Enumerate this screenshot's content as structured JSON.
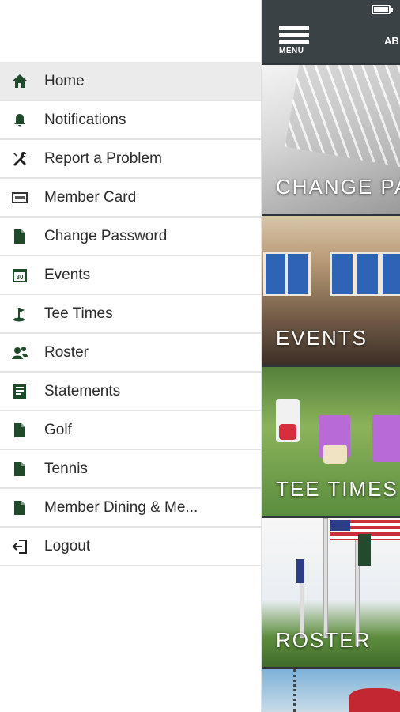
{
  "app": {
    "menu_label": "MENU",
    "header_partial": "AB",
    "tiles": [
      {
        "caption": "CHANGE PA"
      },
      {
        "caption": "EVENTS"
      },
      {
        "caption": "TEE TIMES"
      },
      {
        "caption": "ROSTER"
      }
    ]
  },
  "drawer": {
    "items": [
      {
        "label": "Home",
        "icon": "home-icon",
        "active": true
      },
      {
        "label": "Notifications",
        "icon": "bell-icon"
      },
      {
        "label": "Report a Problem",
        "icon": "tools-icon"
      },
      {
        "label": "Member Card",
        "icon": "card-icon"
      },
      {
        "label": "Change Password",
        "icon": "document-icon"
      },
      {
        "label": "Events",
        "icon": "calendar-icon"
      },
      {
        "label": "Tee Times",
        "icon": "golf-flag-icon"
      },
      {
        "label": "Roster",
        "icon": "people-icon"
      },
      {
        "label": "Statements",
        "icon": "statement-icon"
      },
      {
        "label": "Golf",
        "icon": "document-icon"
      },
      {
        "label": "Tennis",
        "icon": "document-icon"
      },
      {
        "label": "Member Dining & Me...",
        "icon": "document-icon"
      },
      {
        "label": "Logout",
        "icon": "logout-icon"
      }
    ]
  },
  "colors": {
    "icon_green": "#1e4a2a",
    "topbar": "#3a4245"
  }
}
